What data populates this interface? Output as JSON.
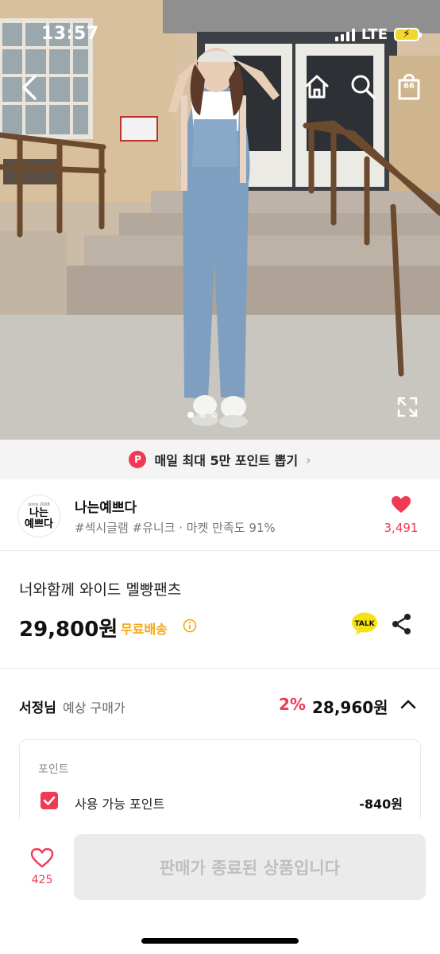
{
  "status_bar": {
    "time": "13:57",
    "network": "LTE"
  },
  "nav": {
    "cart_count": "66"
  },
  "photo": {
    "slide_count": 3,
    "active_slide": 1
  },
  "promo": {
    "badge": "P",
    "text": "매일 최대 5만 포인트 뽑기"
  },
  "seller": {
    "logo_since": "since 2008",
    "logo_line1": "나는",
    "logo_line2": "예쁘다",
    "name": "나는예쁘다",
    "tags": "#섹시글램 #유니크 · 마켓 만족도 91%",
    "like_count": "3,491"
  },
  "product": {
    "name": "너와함께 와이드 멜빵팬츠",
    "price": "29,800원",
    "shipping": "무료배송",
    "talk_label": "TALK"
  },
  "expected": {
    "user": "서정님",
    "label": "예상 구매가",
    "rate": "2%",
    "price": "28,960원"
  },
  "points": {
    "title": "포인트",
    "label": "사용 가능 포인트",
    "value": "-840원",
    "checked": true
  },
  "bottom": {
    "like_count": "425",
    "button_label": "판매가 종료된 상품입니다"
  },
  "colors": {
    "accent": "#ef3a55",
    "shipping": "#f5a80b",
    "talk": "#f7e111"
  }
}
